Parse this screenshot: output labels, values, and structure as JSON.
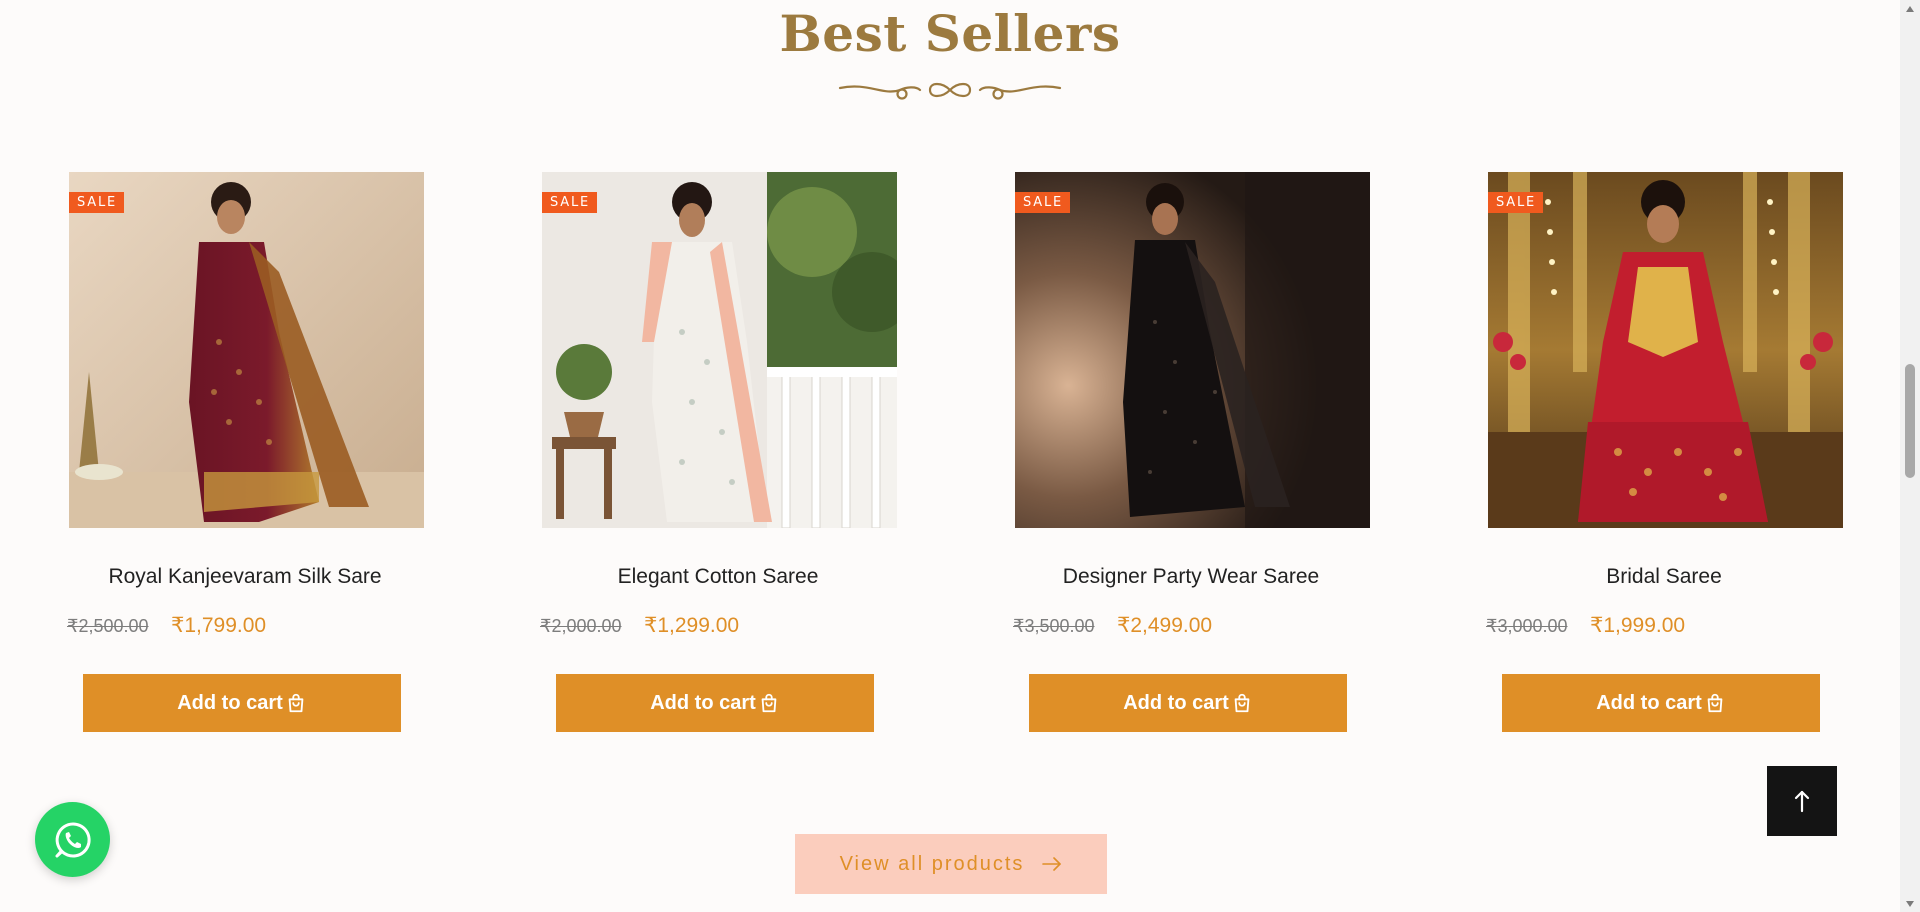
{
  "section": {
    "title": "Best Sellers"
  },
  "colors": {
    "title": "#9c7a3f",
    "accent": "#df8f27",
    "sale_badge": "#f05a1e",
    "view_all_bg": "#fbcdbd",
    "whatsapp": "#25d366"
  },
  "products": [
    {
      "name": "Royal Kanjeevaram Silk Sare",
      "badge": "SALE",
      "old_price": "₹2,500.00",
      "price": "₹1,799.00",
      "cart_label": "Add to cart",
      "image": "woman-in-maroon-gold-silk-saree"
    },
    {
      "name": "Elegant Cotton Saree",
      "badge": "SALE",
      "old_price": "₹2,000.00",
      "price": "₹1,299.00",
      "cart_label": "Add to cart",
      "image": "woman-in-white-peach-cotton-saree"
    },
    {
      "name": "Designer Party Wear Saree",
      "badge": "SALE",
      "old_price": "₹3,500.00",
      "price": "₹2,499.00",
      "cart_label": "Add to cart",
      "image": "woman-in-black-sequin-saree"
    },
    {
      "name": "Bridal Saree",
      "badge": "SALE",
      "old_price": "₹3,000.00",
      "price": "₹1,999.00",
      "cart_label": "Add to cart",
      "image": "bride-in-red-gold-saree"
    }
  ],
  "view_all": {
    "label": "View all products",
    "icon": "arrow-right-icon"
  },
  "back_to_top": {
    "icon": "arrow-up-icon"
  },
  "whatsapp": {
    "icon": "whatsapp-icon"
  },
  "cart_icon": "shopping-bag-icon"
}
